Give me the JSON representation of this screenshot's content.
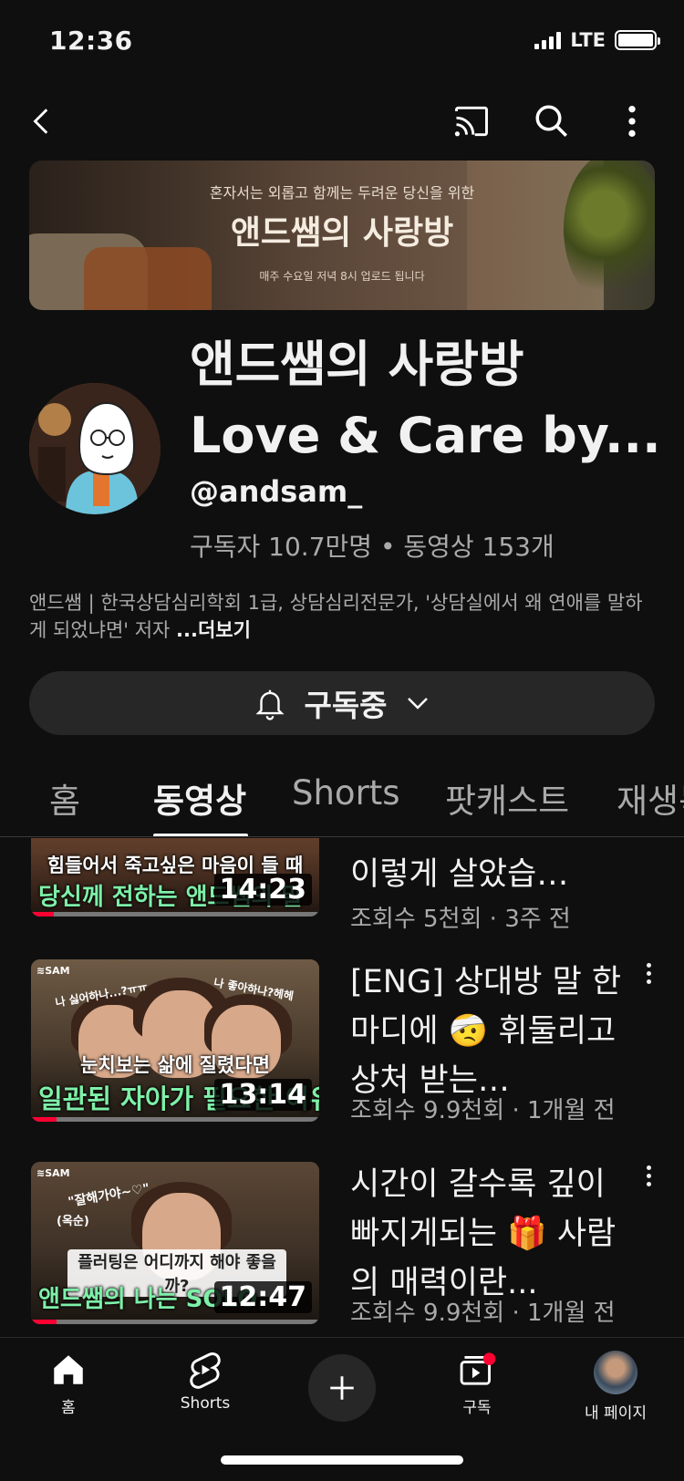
{
  "status": {
    "time": "12:36",
    "network": "LTE"
  },
  "banner": {
    "tagline": "혼자서는 외롭고 함께는 두려운 당신을 위한",
    "title": "앤드쌤의 사랑방",
    "subtitle": "매주 수요일 저녁 8시 업로드 됩니다"
  },
  "channel": {
    "title_line1": "앤드쌤의 사랑방",
    "title_line2": "Love & Care by...",
    "handle": "@andsam_",
    "meta": "구독자 10.7만명 • 동영상 153개",
    "description": "앤드쌤 | 한국상담심리학회 1급, 상담심리전문가, '상담실에서 왜 연애를 말하게 되었냐면' 저자 ",
    "more_label": "...더보기"
  },
  "subscribe": {
    "label": "구독중"
  },
  "tabs": [
    {
      "label": "홈",
      "active": false
    },
    {
      "label": "동영상",
      "active": true
    },
    {
      "label": "Shorts",
      "active": false
    },
    {
      "label": "팟캐스트",
      "active": false
    },
    {
      "label": "재생목록",
      "active": false
    }
  ],
  "videos": [
    {
      "thumb_caption1": "힘들어서 죽고싶은 마음이 들 때",
      "thumb_caption2": "당신께 전하는 앤드쌤의 말",
      "duration": "14:23",
      "title": "이렇게 살았습…",
      "meta": "조회수 5천회 · 3주 전",
      "progress": 0.08
    },
    {
      "thumb_caption1": "눈치보는 삶에 질렸다면",
      "thumb_caption2": "일관된 자아가 필요한 이유",
      "bubble1": "나 싫어하나...?ㅠㅠ",
      "bubble2": "나 좋아하나?헤헤",
      "duration": "13:14",
      "title": "[ENG] 상대방 말 한마디에 🤕 휘둘리고 상처 받는…",
      "meta": "조회수 9.9천회 · 1개월 전",
      "progress": 0.09
    },
    {
      "thumb_caption1": "플러팅은 어디까지 해야 좋을까?",
      "thumb_caption2": "앤드쌤의 나는 SOLO",
      "bubble1": "\"잘해가야~♡\"",
      "bubble2": "(옥순)",
      "duration": "12:47",
      "title": "시간이 갈수록 깊이 빠지게되는 🎁 사람의 매력이란...",
      "meta": "조회수 9.9천회 · 1개월 전",
      "progress": 0.09
    }
  ],
  "bottom_nav": {
    "home": "홈",
    "shorts": "Shorts",
    "subscriptions": "구독",
    "me": "내 페이지"
  },
  "colors": {
    "background": "#0f0f0f",
    "accent": "#ff0033",
    "chip": "#272727"
  }
}
